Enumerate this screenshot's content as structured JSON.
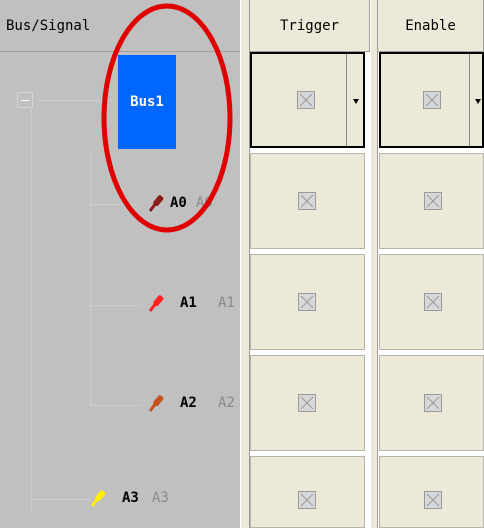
{
  "columns": {
    "bus_signal": "Bus/Signal",
    "trigger": "Trigger",
    "enable": "Enable"
  },
  "bus": {
    "label": "Bus1",
    "expander": "−"
  },
  "signals": [
    {
      "label": "A0",
      "alias": "A0",
      "color": "#8b1a1a"
    },
    {
      "label": "A1",
      "alias": "A1",
      "color": "#ff2020"
    },
    {
      "label": "A2",
      "alias": "A2",
      "color": "#c8501e"
    },
    {
      "label": "A3",
      "alias": "A3",
      "color": "#ffee00"
    }
  ],
  "annotation": {
    "color": "#e00000"
  }
}
